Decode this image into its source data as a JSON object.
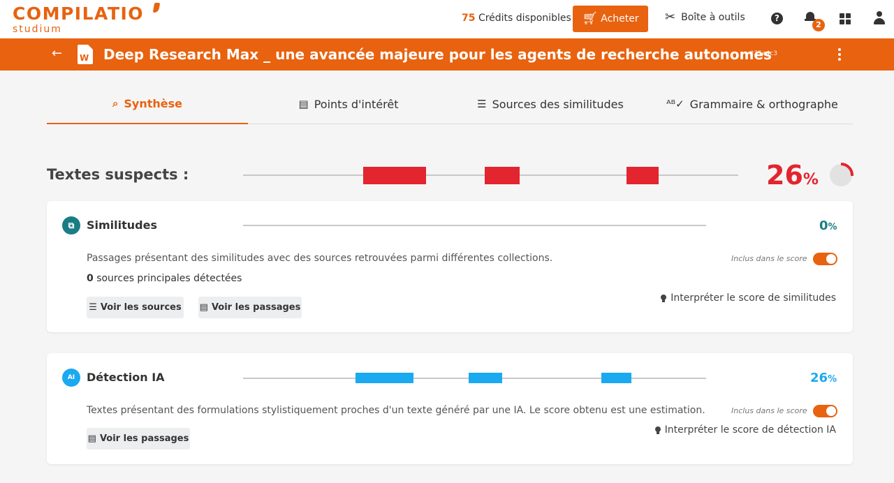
{
  "app": {
    "logo_main": "COMPILATIO",
    "logo_sub": "studium",
    "credits_count": "75",
    "credits_label": "Crédits disponibles",
    "buy_label": "Acheter",
    "toolbox_label": "Boîte à outils",
    "help_glyph": "?",
    "notification_count": "2",
    "accent_color": "#e8620f"
  },
  "document": {
    "back_glyph": "←",
    "word_glyph": "W",
    "title": "Deep Research Max _ une avancée majeure pour les agents de recherche autonomes",
    "hash": "#35e4c3"
  },
  "tabs": [
    {
      "label": "Synthèse",
      "icon": "magnifier-chart-icon",
      "active": true
    },
    {
      "label": "Points d'intérêt",
      "icon": "document-search-icon",
      "active": false
    },
    {
      "label": "Sources des similitudes",
      "icon": "list-tree-icon",
      "active": false
    },
    {
      "label": "Grammaire & orthographe",
      "icon": "spellcheck-icon",
      "active": false
    }
  ],
  "tab_icons": [
    "⌕",
    "▤",
    "☰",
    "ᴬᴮ✓"
  ],
  "suspect": {
    "label": "Textes suspects :",
    "score": "26",
    "pct_sign": "%",
    "score_fraction": 0.26,
    "color": "#e3252f"
  },
  "similitudes": {
    "title": "Similitudes",
    "icon_glyph": "⧉",
    "score": "0",
    "pct_sign": "%",
    "color": "#1a7d85",
    "description": "Passages présentant des similitudes avec des sources retrouvées parmi différentes collections.",
    "sources_count": "0",
    "sources_label": " sources principales détectées",
    "included_label": "Inclus dans le score",
    "included": true,
    "btn_sources": "Voir les sources",
    "btn_passages": "Voir les passages",
    "interpret_label": "Interpréter le score de similitudes"
  },
  "detection_ia": {
    "title": "Détection IA",
    "icon_glyph": "AI",
    "score": "26",
    "pct_sign": "%",
    "color": "#1ba9f0",
    "description": "Textes présentant des formulations stylistiquement proches d'un texte généré par une IA. Le score obtenu est une estimation.",
    "included_label": "Inclus dans le score",
    "included": true,
    "btn_passages": "Voir les passages",
    "interpret_label": "Interpréter le score de détection IA"
  }
}
